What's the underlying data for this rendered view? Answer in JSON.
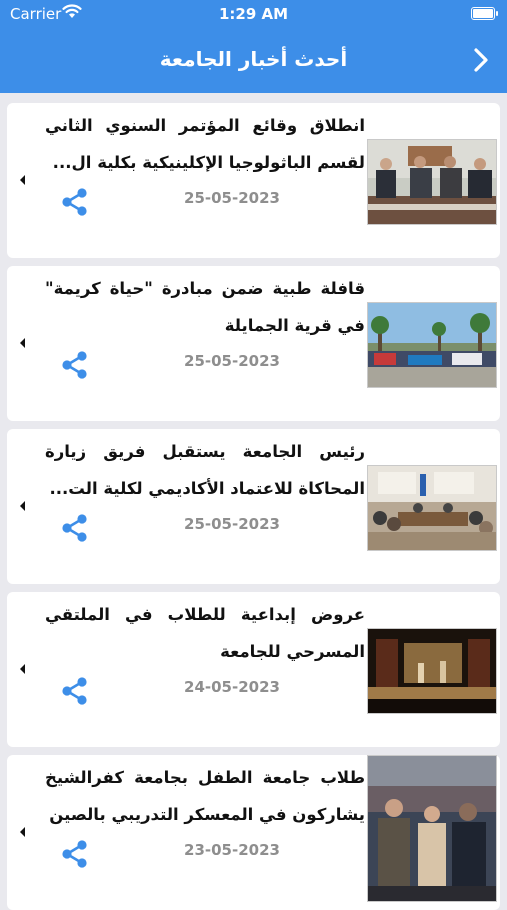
{
  "status_bar": {
    "carrier": "Carrier",
    "time": "1:29 AM"
  },
  "nav": {
    "title": "أحدث أخبار الجامعة",
    "back_icon": "chevron-right-icon"
  },
  "colors": {
    "header": "#3d8ee8",
    "share": "#3d8ee8",
    "date": "#8e8e8e",
    "background": "#e9e9ee"
  },
  "news": [
    {
      "title": "انطلاق وقائع المؤتمر السنوي الثاني لقسم الباثولوجيا الإكلينيكية بكلية ال...",
      "date": "25-05-2023"
    },
    {
      "title": "قافلة طبية ضمن مبادرة \"حياة كريمة\" في قرية الجمايلة",
      "date": "25-05-2023"
    },
    {
      "title": "رئيس الجامعة يستقبل فريق زيارة المحاكاة للاعتماد الأكاديمي لكلية الت...",
      "date": "25-05-2023"
    },
    {
      "title": "عروض إبداعية للطلاب في الملتقي المسرحي للجامعة",
      "date": "24-05-2023"
    },
    {
      "title": "طلاب جامعة الطفل بجامعة كفرالشيخ يشاركون في المعسكر التدريبي بالصين",
      "date": "23-05-2023"
    }
  ]
}
